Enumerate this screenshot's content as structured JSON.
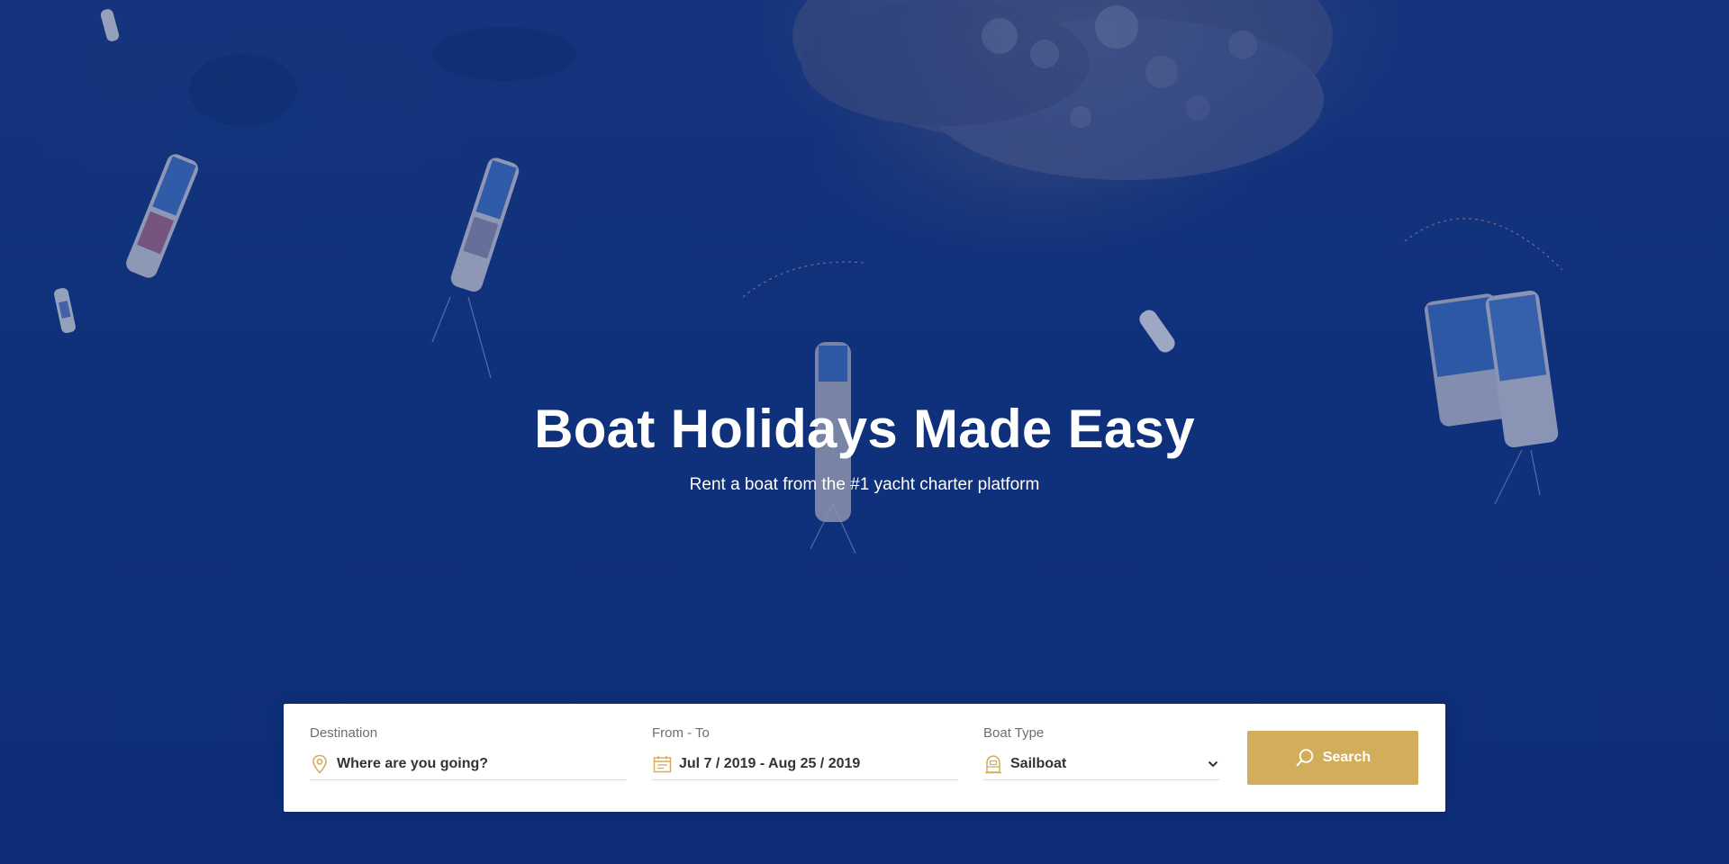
{
  "hero": {
    "title": "Boat Holidays Made Easy",
    "subtitle": "Rent a boat from the #1 yacht charter platform",
    "background_image": "aerial-sea-with-boats"
  },
  "search": {
    "destination": {
      "label": "Destination",
      "value": "Where are you going?",
      "icon": "map-pin-icon"
    },
    "dates": {
      "label": "From - To",
      "value": "Jul 7 / 2019 - Aug 25 / 2019",
      "icon": "calendar-icon"
    },
    "boat_type": {
      "label": "Boat Type",
      "value": "Sailboat",
      "icon": "boat-icon"
    },
    "button_label": "Search"
  },
  "colors": {
    "accent": "#d2ad5b",
    "hero_blue": "#103582",
    "panel_bg": "#ffffff",
    "label_gray": "#6e6e6e",
    "value_dark": "#333333"
  }
}
